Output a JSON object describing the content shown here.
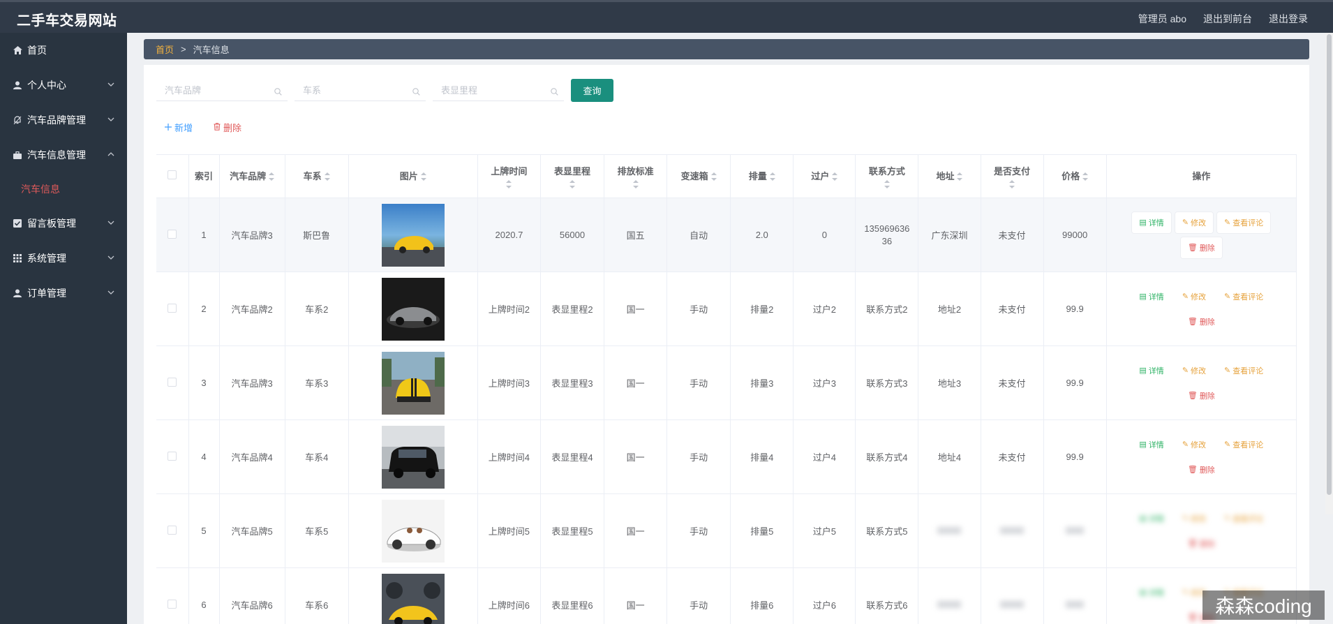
{
  "app": {
    "title": "二手车交易网站"
  },
  "topbar": {
    "admin": "管理员 abo",
    "back_front": "退出到前台",
    "logout": "退出登录"
  },
  "sidebar": {
    "items": [
      {
        "label": "首页",
        "icon": "home-icon",
        "chevron": false
      },
      {
        "label": "个人中心",
        "icon": "user-icon",
        "chevron": true
      },
      {
        "label": "汽车品牌管理",
        "icon": "bell-icon",
        "chevron": true
      },
      {
        "label": "汽车信息管理",
        "icon": "briefcase-icon",
        "chevron": true,
        "expanded": true
      },
      {
        "label": "留言板管理",
        "icon": "checkbox-icon",
        "chevron": true
      },
      {
        "label": "系统管理",
        "icon": "grid-icon",
        "chevron": true
      },
      {
        "label": "订单管理",
        "icon": "user-icon",
        "chevron": true
      }
    ],
    "sub_active": "汽车信息"
  },
  "breadcrumb": {
    "home": "首页",
    "sep": ">",
    "current": "汽车信息"
  },
  "search": {
    "brand_placeholder": "汽车品牌",
    "series_placeholder": "车系",
    "mileage_placeholder": "表显里程",
    "query_label": "查询"
  },
  "actions": {
    "add_label": "新增",
    "delete_label": "删除"
  },
  "table": {
    "headers": {
      "index": "索引",
      "brand": "汽车品牌",
      "series": "车系",
      "image": "图片",
      "reg_time": "上牌时间",
      "mileage": "表显里程",
      "emission": "排放标准",
      "gearbox": "变速箱",
      "displacement": "排量",
      "transfer": "过户",
      "contact": "联系方式",
      "address": "地址",
      "paid": "是否支付",
      "price": "价格",
      "ops": "操作"
    },
    "op_labels": {
      "detail": "详情",
      "edit": "修改",
      "review": "查看评论",
      "delete": "删除"
    },
    "rows": [
      {
        "index": "1",
        "brand": "汽车品牌3",
        "series": "斯巴鲁",
        "reg_time": "2020.7",
        "mileage": "56000",
        "emission": "国五",
        "gearbox": "自动",
        "displacement": "2.0",
        "transfer": "0",
        "contact": "13596963636",
        "address": "广东深圳",
        "paid": "未支付",
        "price": "99000"
      },
      {
        "index": "2",
        "brand": "汽车品牌2",
        "series": "车系2",
        "reg_time": "上牌时间2",
        "mileage": "表显里程2",
        "emission": "国一",
        "gearbox": "手动",
        "displacement": "排量2",
        "transfer": "过户2",
        "contact": "联系方式2",
        "address": "地址2",
        "paid": "未支付",
        "price": "99.9"
      },
      {
        "index": "3",
        "brand": "汽车品牌3",
        "series": "车系3",
        "reg_time": "上牌时间3",
        "mileage": "表显里程3",
        "emission": "国一",
        "gearbox": "手动",
        "displacement": "排量3",
        "transfer": "过户3",
        "contact": "联系方式3",
        "address": "地址3",
        "paid": "未支付",
        "price": "99.9"
      },
      {
        "index": "4",
        "brand": "汽车品牌4",
        "series": "车系4",
        "reg_time": "上牌时间4",
        "mileage": "表显里程4",
        "emission": "国一",
        "gearbox": "手动",
        "displacement": "排量4",
        "transfer": "过户4",
        "contact": "联系方式4",
        "address": "地址4",
        "paid": "未支付",
        "price": "99.9"
      },
      {
        "index": "5",
        "brand": "汽车品牌5",
        "series": "车系5",
        "reg_time": "上牌时间5",
        "mileage": "表显里程5",
        "emission": "国一",
        "gearbox": "手动",
        "displacement": "排量5",
        "transfer": "过户5",
        "contact": "联系方式5",
        "address": "",
        "paid": "",
        "price": ""
      },
      {
        "index": "6",
        "brand": "汽车品牌6",
        "series": "车系6",
        "reg_time": "上牌时间6",
        "mileage": "表显里程6",
        "emission": "国一",
        "gearbox": "手动",
        "displacement": "排量6",
        "transfer": "过户6",
        "contact": "联系方式6",
        "address": "",
        "paid": "",
        "price": ""
      }
    ]
  },
  "watermark": "森森coding",
  "colors": {
    "topbar": "#303a48",
    "sidebar": "#293440",
    "accent": "#1a8f7e",
    "breadcrumb_home": "#f3b23e",
    "danger": "#e05a5a"
  }
}
